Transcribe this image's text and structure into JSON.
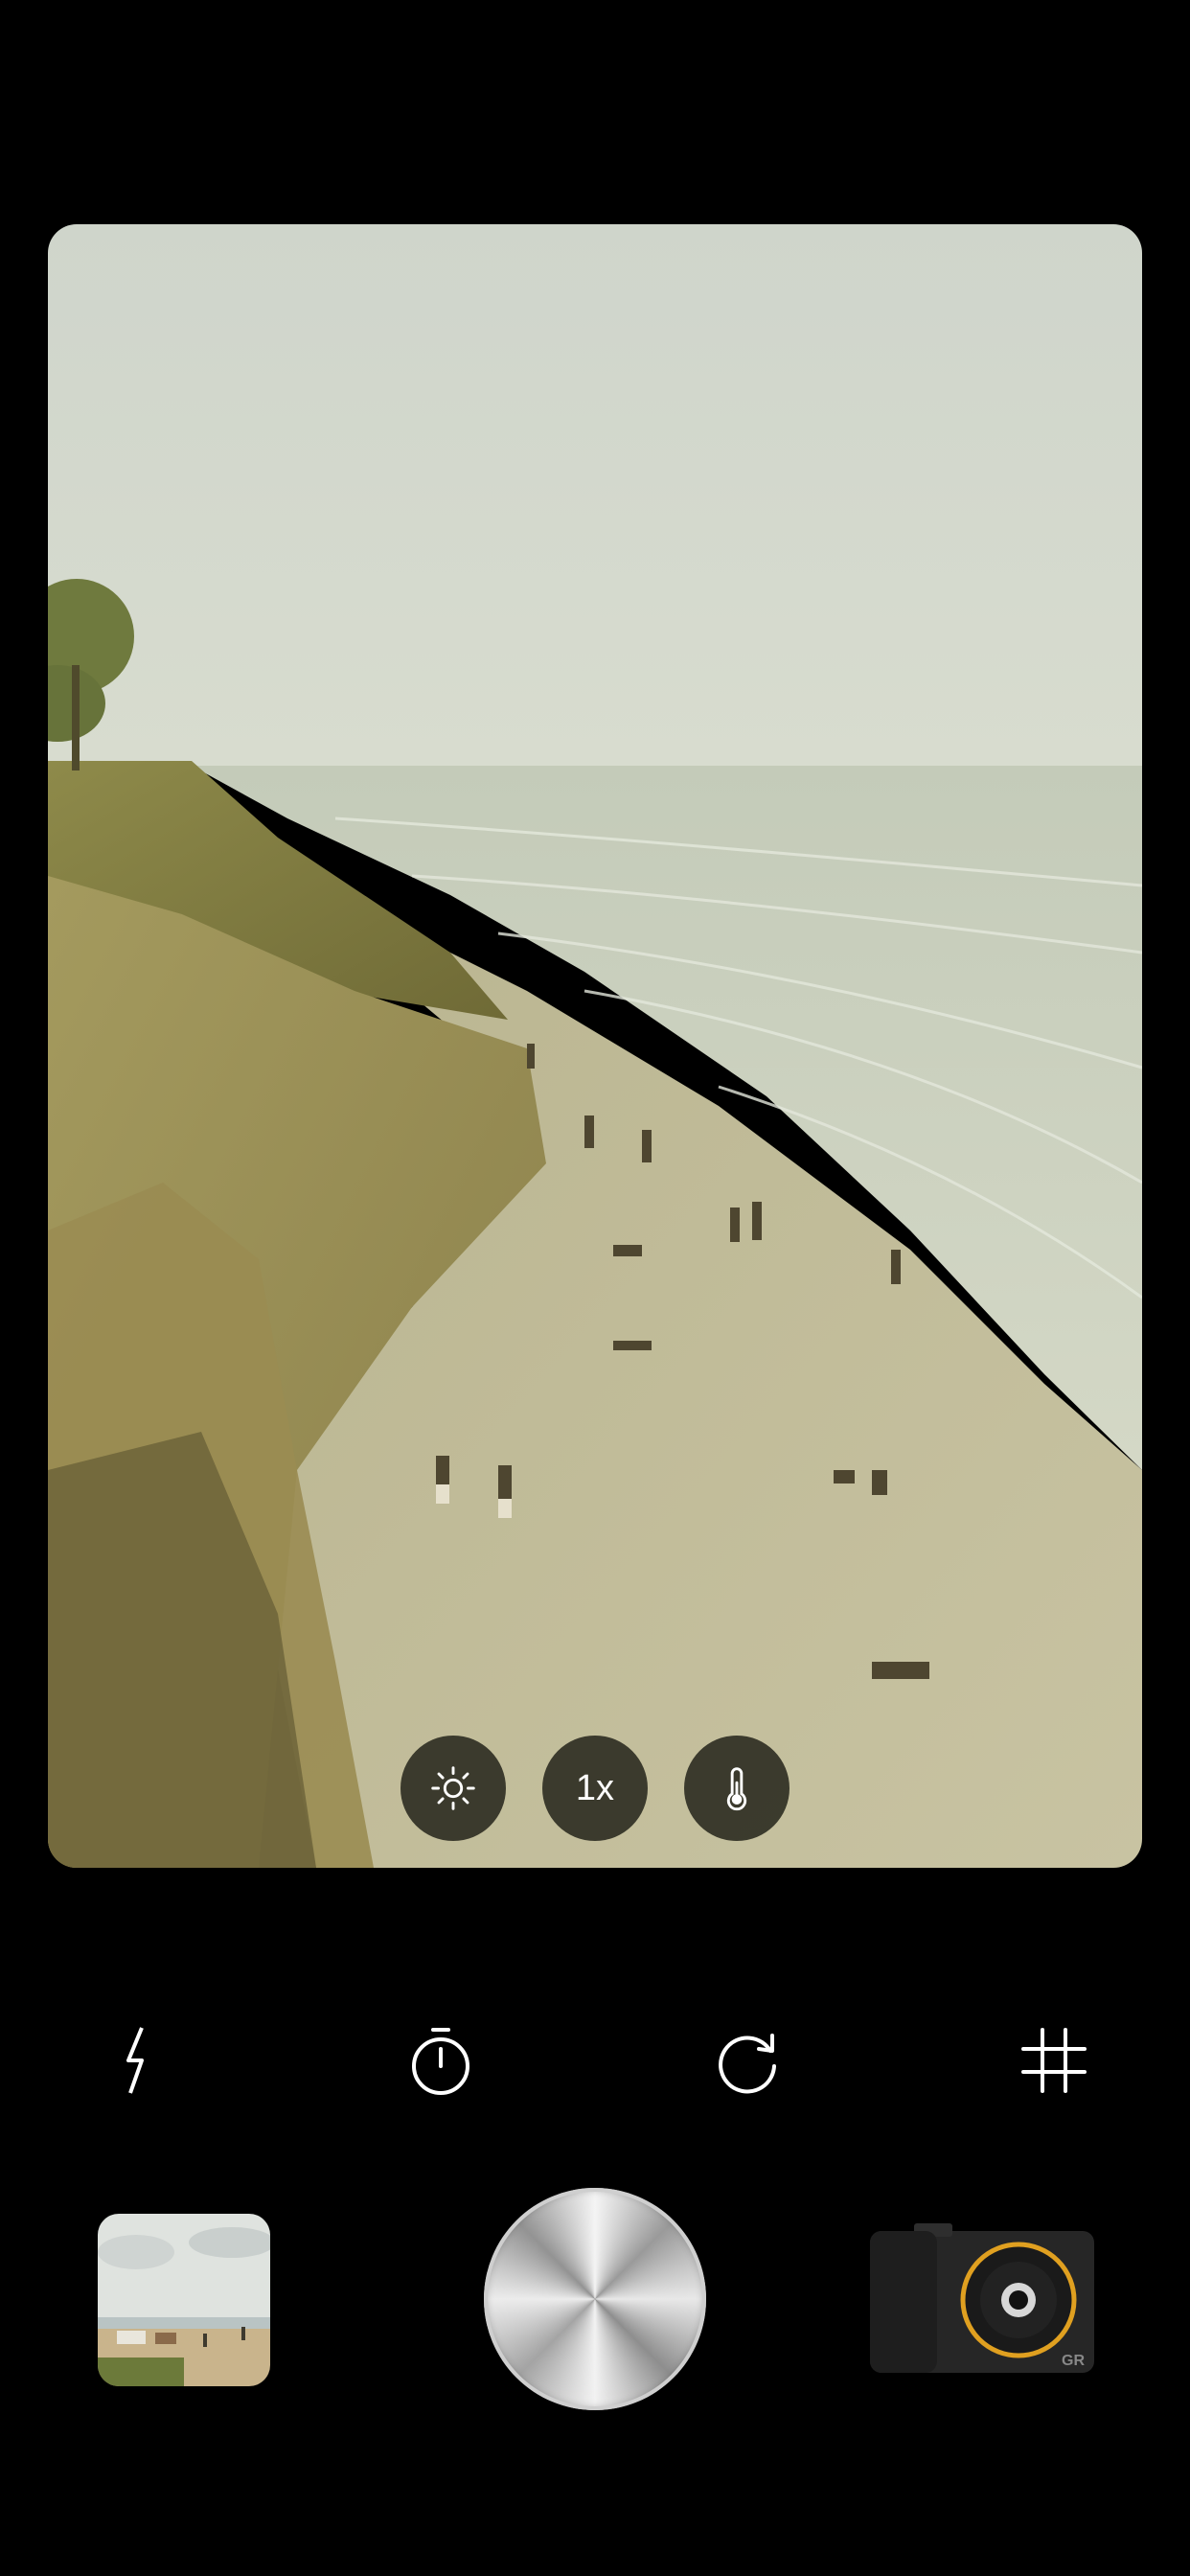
{
  "viewfinder": {
    "quick_controls": [
      {
        "id": "exposure",
        "icon": "sun-icon",
        "label": ""
      },
      {
        "id": "zoom",
        "icon": "",
        "label": "1x"
      },
      {
        "id": "white-balance",
        "icon": "thermometer-icon",
        "label": ""
      }
    ]
  },
  "tools": [
    {
      "id": "flash",
      "icon": "lightning-bolt-icon"
    },
    {
      "id": "timer",
      "icon": "timer-icon"
    },
    {
      "id": "flip",
      "icon": "rotate-icon"
    },
    {
      "id": "grid",
      "icon": "grid-icon"
    }
  ],
  "bottom": {
    "gallery_thumbnail": "beach-photo-thumbnail",
    "shutter": "shutter-button",
    "camera_model_icon": "compact-camera-icon",
    "camera_badge": "GR"
  },
  "colors": {
    "background": "#000000",
    "accent_ring": "#e0a020",
    "control_bg": "#28281e"
  }
}
